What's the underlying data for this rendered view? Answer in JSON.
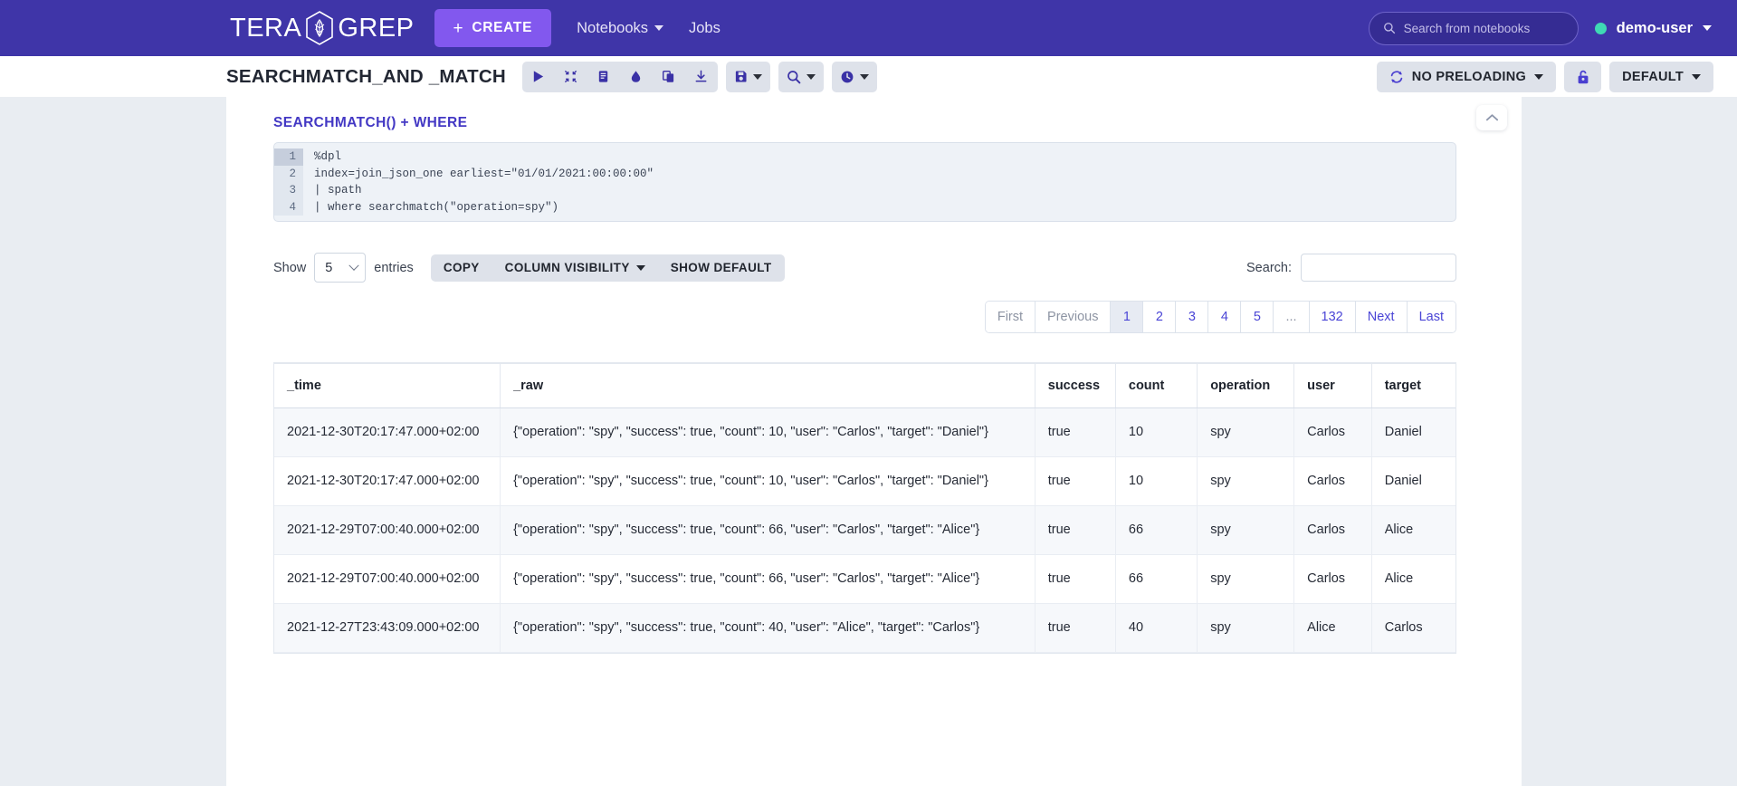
{
  "navbar": {
    "brand_left": "TERA",
    "brand_right": "GREP",
    "create_label": "CREATE",
    "create_plus": "+",
    "nav_notebooks": "Notebooks",
    "nav_jobs": "Jobs",
    "search_placeholder": "Search from notebooks",
    "user_name": "demo-user",
    "brand_color": "#3F35A8",
    "create_color": "#8258EE",
    "status_color": "#3FD9B4"
  },
  "toolbar": {
    "notebook_title": "SEARCHMATCH_AND _MATCH",
    "run_icon": "play-icon",
    "collapse_icon": "compress-icon",
    "book_icon": "book-icon",
    "erase_icon": "eraser-icon",
    "copy_icon": "copy-icon",
    "download_icon": "download-icon",
    "save_icon": "save-icon",
    "search_icon": "search-icon",
    "clock_icon": "clock-icon",
    "preloading_label": "NO PRELOADING",
    "preloading_icon": "refresh-icon",
    "lock_icon": "unlock-icon",
    "interpreter_label": "DEFAULT"
  },
  "paragraph": {
    "title": "SEARCHMATCH() + WHERE",
    "collapse_icon": "chevron-up-icon",
    "code_lines": [
      {
        "num": "1",
        "text": "%dpl",
        "active": true
      },
      {
        "num": "2",
        "text": "index=join_json_one earliest=\"01/01/2021:00:00:00\"",
        "active": false
      },
      {
        "num": "3",
        "text": "| spath",
        "active": false
      },
      {
        "num": "4",
        "text": "| where searchmatch(\"operation=spy\")",
        "active": false
      }
    ]
  },
  "controls": {
    "show_label": "Show",
    "entries_value": "5",
    "entries_label": "entries",
    "copy_label": "COPY",
    "column_visibility_label": "COLUMN VISIBILITY",
    "show_default_label": "SHOW DEFAULT",
    "search_label": "Search:",
    "search_value": "",
    "search_placeholder": ""
  },
  "pagination": {
    "first": "First",
    "previous": "Previous",
    "pages": [
      "1",
      "2",
      "3",
      "4",
      "5"
    ],
    "ellipsis": "...",
    "last_page": "132",
    "next": "Next",
    "last": "Last",
    "active_page": "1"
  },
  "table": {
    "headers": [
      "_time",
      "_raw",
      "success",
      "count",
      "operation",
      "user",
      "target"
    ],
    "rows": [
      {
        "time": "2021-12-30T20:17:47.000+02:00",
        "raw": "{\"operation\": \"spy\", \"success\": true, \"count\": 10, \"user\": \"Carlos\", \"target\": \"Daniel\"}",
        "success": "true",
        "count": "10",
        "operation": "spy",
        "user": "Carlos",
        "target": "Daniel"
      },
      {
        "time": "2021-12-30T20:17:47.000+02:00",
        "raw": "{\"operation\": \"spy\", \"success\": true, \"count\": 10, \"user\": \"Carlos\", \"target\": \"Daniel\"}",
        "success": "true",
        "count": "10",
        "operation": "spy",
        "user": "Carlos",
        "target": "Daniel"
      },
      {
        "time": "2021-12-29T07:00:40.000+02:00",
        "raw": "{\"operation\": \"spy\", \"success\": true, \"count\": 66, \"user\": \"Carlos\", \"target\": \"Alice\"}",
        "success": "true",
        "count": "66",
        "operation": "spy",
        "user": "Carlos",
        "target": "Alice"
      },
      {
        "time": "2021-12-29T07:00:40.000+02:00",
        "raw": "{\"operation\": \"spy\", \"success\": true, \"count\": 66, \"user\": \"Carlos\", \"target\": \"Alice\"}",
        "success": "true",
        "count": "66",
        "operation": "spy",
        "user": "Carlos",
        "target": "Alice"
      },
      {
        "time": "2021-12-27T23:43:09.000+02:00",
        "raw": "{\"operation\": \"spy\", \"success\": true, \"count\": 40, \"user\": \"Alice\", \"target\": \"Carlos\"}",
        "success": "true",
        "count": "40",
        "operation": "spy",
        "user": "Alice",
        "target": "Carlos"
      }
    ]
  }
}
